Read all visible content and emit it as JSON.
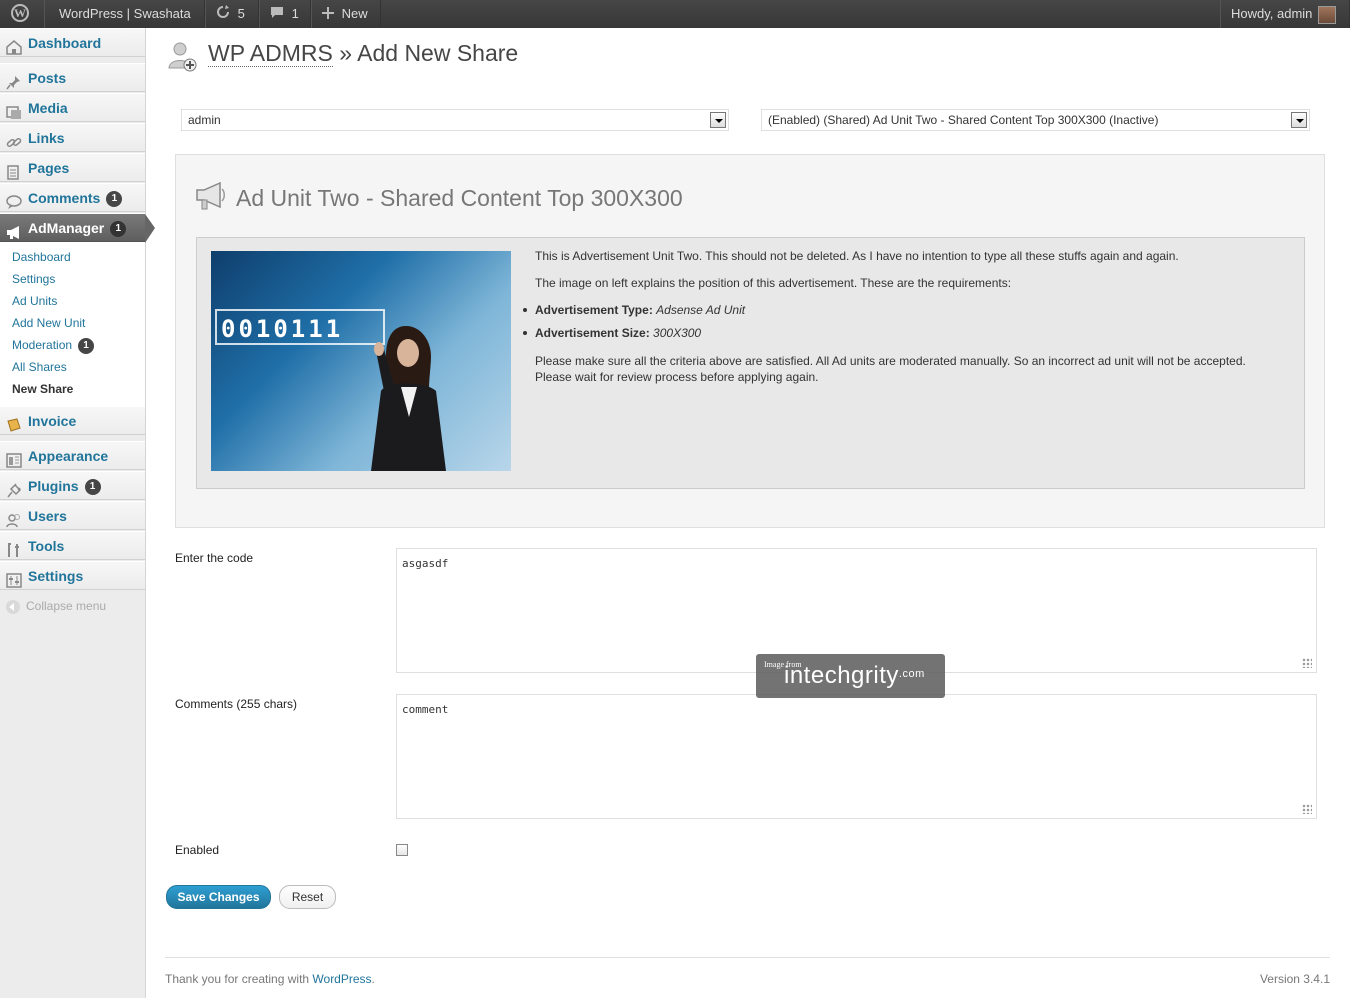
{
  "adminbar": {
    "site_name": "WordPress | Swashata",
    "updates_count": "5",
    "comments_count": "1",
    "new_label": "New",
    "howdy": "Howdy, admin"
  },
  "sidebar": {
    "items": [
      {
        "label": "Dashboard",
        "icon": "dashboard-icon"
      },
      {
        "label": "Posts",
        "icon": "pin-icon"
      },
      {
        "label": "Media",
        "icon": "media-icon"
      },
      {
        "label": "Links",
        "icon": "link-icon"
      },
      {
        "label": "Pages",
        "icon": "page-icon"
      },
      {
        "label": "Comments",
        "icon": "comment-bubble-icon",
        "badge": "1"
      },
      {
        "label": "AdManager",
        "icon": "megaphone-icon",
        "badge": "1"
      },
      {
        "label": "Invoice",
        "icon": "invoice-icon"
      },
      {
        "label": "Appearance",
        "icon": "appearance-icon"
      },
      {
        "label": "Plugins",
        "icon": "plug-icon",
        "badge": "1"
      },
      {
        "label": "Users",
        "icon": "users-icon"
      },
      {
        "label": "Tools",
        "icon": "tools-icon"
      },
      {
        "label": "Settings",
        "icon": "settings-icon"
      }
    ],
    "submenu": [
      {
        "label": "Dashboard"
      },
      {
        "label": "Settings"
      },
      {
        "label": "Ad Units"
      },
      {
        "label": "Add New Unit"
      },
      {
        "label": "Moderation",
        "badge": "1"
      },
      {
        "label": "All Shares"
      },
      {
        "label": "New Share"
      }
    ],
    "collapse_label": "Collapse menu"
  },
  "page": {
    "title_acronym": "WP ADMRS",
    "title_rest": " » Add New Share",
    "user_select": "admin",
    "unit_select": "(Enabled) (Shared) Ad Unit Two - Shared Content Top 300X300 (Inactive)"
  },
  "unit": {
    "title": "Ad Unit Two - Shared Content Top 300X300",
    "image_digits": "0010111",
    "desc1": "This is Advertisement Unit Two. This should not be deleted. As I have no intention to type all these stuffs again and again.",
    "desc2": "The image on left explains the position of this advertisement. These are the requirements:",
    "type_label": "Advertisement Type:",
    "type_value": "Adsense Ad Unit",
    "size_label": "Advertisement Size:",
    "size_value": "300X300",
    "note1": "Please make sure all the criteria above are satisfied. All Ad units are moderated manually. So an incorrect ad unit will not be accepted.",
    "note2": "Please wait for review process before applying again."
  },
  "form": {
    "code_label": "Enter the code",
    "code_value": "asgasdf",
    "comments_label": "Comments (255 chars)",
    "comments_value": "comment",
    "enabled_label": "Enabled",
    "enabled_checked": false,
    "save_label": "Save Changes",
    "reset_label": "Reset"
  },
  "footer": {
    "thanks_prefix": "Thank you for creating with ",
    "thanks_link": "WordPress",
    "thanks_suffix": ".",
    "version": "Version 3.4.1"
  },
  "watermark": {
    "small": "Image from",
    "brand": "intechgrity",
    "tld": ".com"
  },
  "colors": {
    "link": "#21759b",
    "adminbar": "#464646",
    "badge": "#464646",
    "primary_button": "#21759b"
  }
}
